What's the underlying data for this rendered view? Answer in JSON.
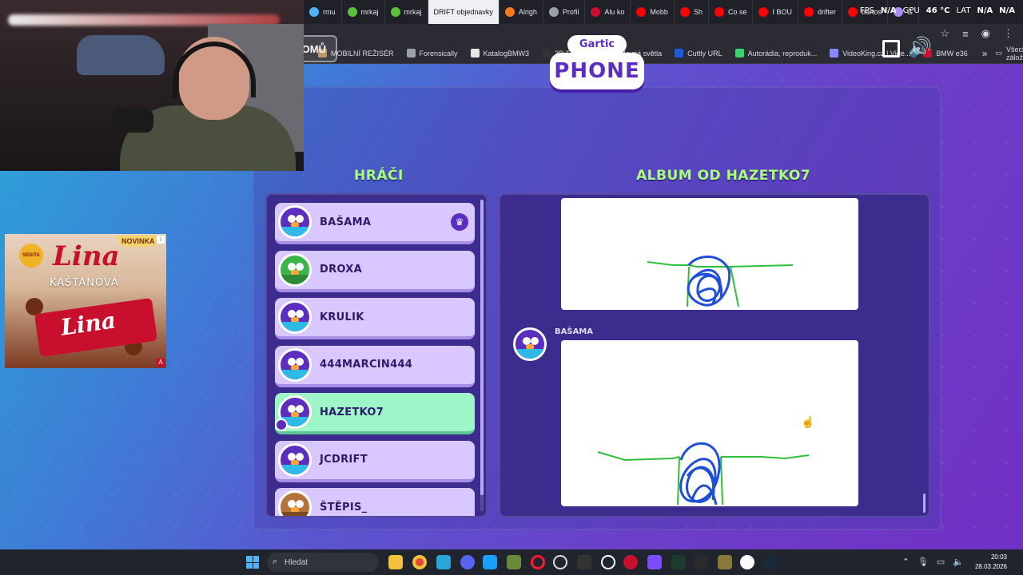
{
  "browser": {
    "tabs": [
      {
        "label": "rmu",
        "color": "#4fb3ff"
      },
      {
        "label": "mrkaj",
        "color": "#5ac13a"
      },
      {
        "label": "mrkaj",
        "color": "#5ac13a"
      },
      {
        "label": "DRIFT objednavky",
        "color": "#ffffff",
        "active": true
      },
      {
        "label": "Alrigh",
        "color": "#ff7a1a"
      },
      {
        "label": "Profil",
        "color": "#9aa0a6"
      },
      {
        "label": "Alu ko",
        "color": "#c8102e"
      },
      {
        "label": "Mobb",
        "color": "#ff0000"
      },
      {
        "label": "Sh",
        "color": "#ff0000"
      },
      {
        "label": "Co se",
        "color": "#ff0000"
      },
      {
        "label": "I BOU",
        "color": "#ff0000"
      },
      {
        "label": "drifter",
        "color": "#ff0000"
      },
      {
        "label": "bartos",
        "color": "#ff0000"
      },
      {
        "label": "G",
        "color": "#a78bfa"
      }
    ],
    "hud": {
      "fps_label": "FPS",
      "fps_value": "N/A",
      "gpu_label": "GPU",
      "gpu_temp": "46 °C",
      "lat_label": "LAT",
      "lat_value": "N/A",
      "extra_value": "N/A"
    },
    "bookmarks": [
      {
        "label": "MOBILNÍ REŽISÉR",
        "color": "#b58b5a"
      },
      {
        "label": "Forensically",
        "color": "#9aa0a6"
      },
      {
        "label": "KatalogBMW3",
        "color": "#e6e6e6"
      },
      {
        "label": "3D FOLIE",
        "color": "#333333"
      },
      {
        "label": "Přídavná světla",
        "color": "#f5c518"
      },
      {
        "label": "Cuttly URL",
        "color": "#1f5bd8"
      },
      {
        "label": "Autorádia, reproduk...",
        "color": "#3bd16f"
      },
      {
        "label": "VideoKing.cz | Vide...",
        "color": "#8a8aff"
      },
      {
        "label": "BMW e36",
        "color": "#c8102e"
      }
    ],
    "bookmarks_more": "»",
    "all_bookmarks": "Všechny záložky"
  },
  "game": {
    "back_label": "OMŮ",
    "logo_top": "Gartic",
    "logo_bottom": "PHONE",
    "players_title": "HRÁČI",
    "album_title": "ALBUM OD HAZETKO7",
    "players": [
      {
        "name": "BAŠAMA",
        "avatar": "purple",
        "crown": true
      },
      {
        "name": "DROXA",
        "avatar": "green"
      },
      {
        "name": "KRULIK",
        "avatar": "purple"
      },
      {
        "name": "444MARCIN444",
        "avatar": "purple"
      },
      {
        "name": "HAZETKO7",
        "avatar": "purple",
        "highlight": true,
        "host": true
      },
      {
        "name": "JCDRIFT",
        "avatar": "purple"
      },
      {
        "name": "ŠTĚPIS_",
        "avatar": "brown"
      }
    ],
    "album_entry_author": "BAŠAMA"
  },
  "ad": {
    "badge": "NOVINKA",
    "seal": "SEDITA",
    "brand": "Lina",
    "flavor": "KAŠTANOVÁ",
    "bar_text": "Lina",
    "info": "i",
    "adchoice": "A"
  },
  "taskbar": {
    "search_placeholder": "Hledat",
    "time": "20:03",
    "date": "28.03.2026"
  }
}
